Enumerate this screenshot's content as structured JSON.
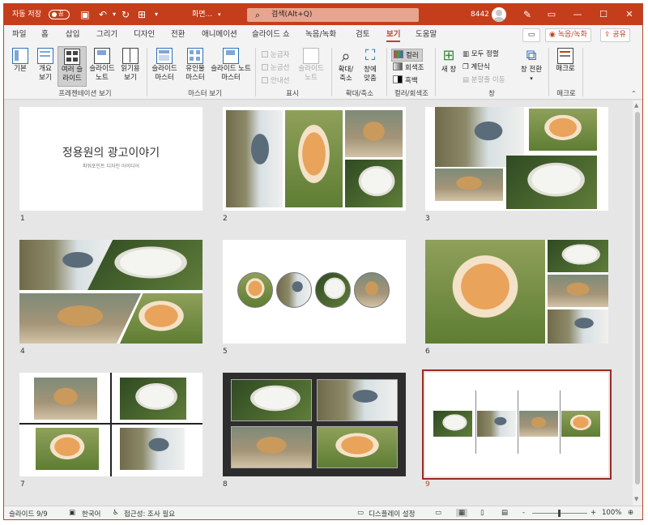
{
  "titlebar": {
    "autosave": "자동 저장",
    "autosave_state": "끔",
    "filename": "화면...",
    "search_placeholder": "검색(Alt+Q)",
    "user_id": "8442",
    "save_icon": "save-icon",
    "undo_icon": "undo-icon",
    "redo_icon": "redo-icon"
  },
  "menu": {
    "tabs": [
      "파일",
      "홈",
      "삽입",
      "그리기",
      "디자인",
      "전환",
      "애니메이션",
      "슬라이드 쇼",
      "녹음/녹화",
      "검토",
      "보기",
      "도움말"
    ],
    "active_tab": "보기",
    "record_button": "녹음/녹화",
    "share_button": "공유"
  },
  "ribbon": {
    "presentation_views": {
      "normal": "기본",
      "outline": "개요 보기",
      "sorter": "여러 슬라이드",
      "notes": "슬라이드 노트",
      "reading": "읽기용 보기",
      "group_label": "프레젠테이션 보기"
    },
    "master_views": {
      "slide_master": "슬라이드 마스터",
      "handout_master": "유인물 마스터",
      "notes_master": "슬라이드 노트 마스터",
      "group_label": "마스터 보기"
    },
    "show": {
      "ruler": "눈금자",
      "gridlines": "눈금선",
      "guides": "안내선",
      "notes": "슬라이드 노트",
      "group_label": "표시"
    },
    "zoom": {
      "zoom": "확대/축소",
      "fit": "창에 맞춤",
      "group_label": "확대/축소"
    },
    "color": {
      "color": "컬러",
      "grayscale": "회색조",
      "bw": "흑백",
      "group_label": "컬러/회색조"
    },
    "window": {
      "new_window": "새 창",
      "arrange_all": "모두 정렬",
      "cascade": "계단식",
      "move_split": "분할줄 이동",
      "switch": "창 전환",
      "group_label": "창"
    },
    "macros": {
      "macro": "매크로",
      "group_label": "매크로"
    }
  },
  "slides": {
    "title_slide": {
      "title": "정용원의 광고이야기",
      "subtitle": "파워포인트 디자인 아이디어"
    },
    "numbers": [
      "1",
      "2",
      "3",
      "4",
      "5",
      "6",
      "7",
      "8",
      "9"
    ],
    "selected": 9,
    "photo_icons": {
      "corgi": "dog-photo-icon",
      "squirrel": "squirrel-photo-icon",
      "cat": "cat-photo-icon",
      "white_dog": "white-dog-photo-icon"
    }
  },
  "status": {
    "slide_info": "슬라이드 9/9",
    "language": "한국어",
    "accessibility": "접근성: 조사 필요",
    "display_settings": "디스플레이 설정",
    "zoom_percent": "100%",
    "zoom_minus": "-",
    "zoom_plus": "+"
  },
  "colors": {
    "accent": "#c43e1c",
    "selected_outline": "#9b2a22",
    "canvas": "#e6e6e6"
  }
}
